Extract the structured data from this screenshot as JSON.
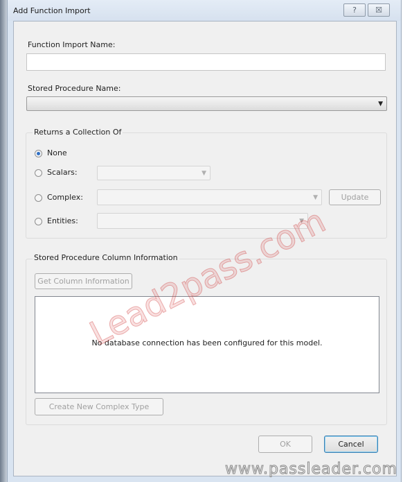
{
  "stray_char": "?",
  "window": {
    "title": "Add Function Import",
    "help_label": "?",
    "close_label": "☒"
  },
  "function_import_name": {
    "label": "Function Import Name:",
    "value": ""
  },
  "stored_procedure": {
    "label": "Stored Procedure Name:",
    "value": ""
  },
  "returns": {
    "group_label": "Returns a Collection Of",
    "options": [
      {
        "label": "None",
        "selected": true
      },
      {
        "label": "Scalars:",
        "selected": false
      },
      {
        "label": "Complex:",
        "selected": false
      },
      {
        "label": "Entities:",
        "selected": false
      }
    ],
    "update_label": "Update"
  },
  "column_info": {
    "group_label": "Stored Procedure Column Information",
    "get_columns_label": "Get Column Information",
    "message": "No database connection has been configured for this model.",
    "create_complex_label": "Create New Complex Type"
  },
  "buttons": {
    "ok": "OK",
    "cancel": "Cancel"
  },
  "icons": {
    "dropdown": "chevron-down-icon"
  },
  "watermarks": {
    "center": "Lead2pass.com",
    "footer": "www.passleader.com"
  }
}
